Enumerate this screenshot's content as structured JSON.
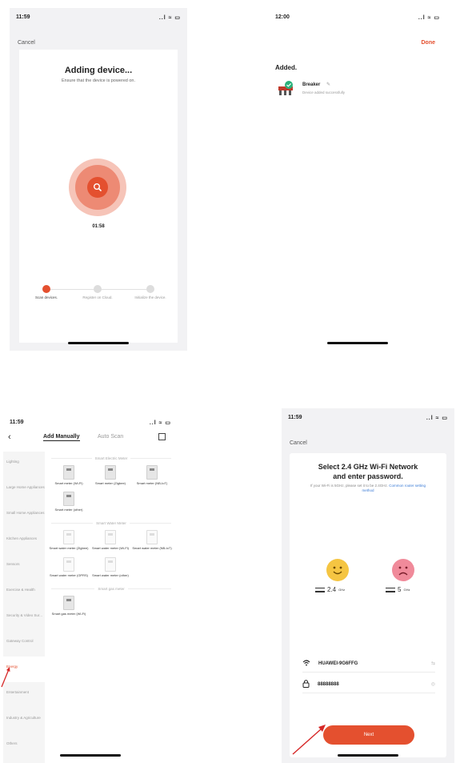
{
  "screen1": {
    "time": "11:59",
    "signal": "..l ≈ ▭",
    "cancel": "Cancel",
    "title": "Adding device...",
    "subtitle": "Ensure that the device is powered on.",
    "timer": "01:58",
    "steps": [
      {
        "label": "Scan devices.",
        "active": true
      },
      {
        "label": "Register on Cloud.",
        "active": false
      },
      {
        "label": "Initialize the device.",
        "active": false
      }
    ]
  },
  "screen2": {
    "time": "12:00",
    "signal": "..l ≈ ▭",
    "done": "Done",
    "added": "Added.",
    "device_name": "Breaker",
    "device_status": "Device added successfully"
  },
  "screen3": {
    "time": "11:59",
    "signal": "..l ≈ ▭",
    "tab_manual": "Add Manually",
    "tab_auto": "Auto Scan",
    "sidebar": [
      {
        "label": "Lighting",
        "active": false
      },
      {
        "label": "Large Home Appliances",
        "active": false
      },
      {
        "label": "Small Home Appliances",
        "active": false
      },
      {
        "label": "Kitchen Appliances",
        "active": false
      },
      {
        "label": "Sensors",
        "active": false
      },
      {
        "label": "Exercise & Health",
        "active": false
      },
      {
        "label": "Security & Video Sur...",
        "active": false
      },
      {
        "label": "Gateway Control",
        "active": false
      },
      {
        "label": "Energy",
        "active": true
      },
      {
        "label": "Entertainment",
        "active": false
      },
      {
        "label": "Industry & Agriculture",
        "active": false
      },
      {
        "label": "Others",
        "active": false
      }
    ],
    "sections": [
      {
        "title": "Smart Electric Meter",
        "items": [
          "Smart meter (Wi-Fi)",
          "Smart meter (Zigbee)",
          "Smart meter (NB-IoT)",
          "Smart meter (other)"
        ]
      },
      {
        "title": "Smart Water Meter",
        "items": [
          "Smart water meter (Zigbee)",
          "Smart water meter (Wi-Fi)",
          "Smart water meter (NB-IoT)",
          "Smart water meter (GPRS)",
          "Smart water meter (other)"
        ]
      },
      {
        "title": "Smart gas meter",
        "items": [
          "Smart gas meter (Wi-Fi)"
        ]
      }
    ]
  },
  "screen4": {
    "time": "11:59",
    "signal": "..l ≈ ▭",
    "cancel": "Cancel",
    "title_line1": "Select 2.4 GHz Wi-Fi Network",
    "title_line2": "and enter password.",
    "desc": "If your Wi-Fi is 5GHz, please set it to be 2.4GHz.",
    "desc_link": "Common router setting method",
    "band_24": "2.4",
    "band_5": "5",
    "band_unit": "GHz",
    "ssid": "HUAWEI-9G6FFG",
    "password": "88888888",
    "next": "Next"
  },
  "colors": {
    "accent": "#e4502f",
    "link": "#3b7bd6",
    "happy": "#f5c542",
    "sad": "#f08a9a"
  }
}
